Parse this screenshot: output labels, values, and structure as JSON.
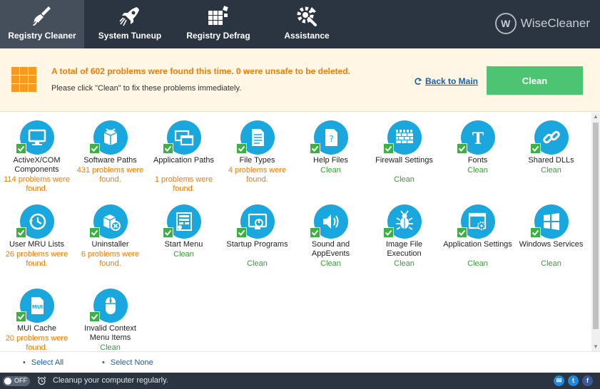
{
  "toolbar": {
    "tabs": [
      {
        "label": "Registry Cleaner",
        "icon": "broom-icon",
        "active": true
      },
      {
        "label": "System Tuneup",
        "icon": "rocket-icon",
        "active": false
      },
      {
        "label": "Registry Defrag",
        "icon": "defrag-icon",
        "active": false
      },
      {
        "label": "Assistance",
        "icon": "tools-icon",
        "active": false
      }
    ],
    "brand": "WiseCleaner",
    "brand_mark": "W"
  },
  "banner": {
    "title": "A total of 602 problems were found this time. 0 were unsafe to be deleted.",
    "subtitle": "Please click \"Clean\" to fix these problems immediately.",
    "back_label": "Back to Main",
    "clean_label": "Clean"
  },
  "items": [
    {
      "name": "ActiveX/COM Components",
      "status": "114 problems were found.",
      "kind": "warn",
      "icon": "monitor-icon",
      "checked": true
    },
    {
      "name": "Software Paths",
      "status": "431 problems were found.",
      "kind": "warn",
      "icon": "package-icon",
      "checked": true
    },
    {
      "name": "Application Paths",
      "status": "1 problems were found.",
      "kind": "warn",
      "icon": "windows-icon",
      "checked": true
    },
    {
      "name": "File Types",
      "status": "4 problems were found.",
      "kind": "warn",
      "icon": "file-icon",
      "checked": true
    },
    {
      "name": "Help Files",
      "status": "Clean",
      "kind": "ok",
      "icon": "help-file-icon",
      "checked": true
    },
    {
      "name": "Firewall Settings",
      "status": "Clean",
      "kind": "ok",
      "icon": "firewall-icon",
      "checked": true
    },
    {
      "name": "Fonts",
      "status": "Clean",
      "kind": "ok",
      "icon": "font-icon",
      "checked": true
    },
    {
      "name": "Shared DLLs",
      "status": "Clean",
      "kind": "ok",
      "icon": "link-icon",
      "checked": true
    },
    {
      "name": "User MRU Lists",
      "status": "26 problems were found.",
      "kind": "warn",
      "icon": "clock-icon",
      "checked": true
    },
    {
      "name": "Uninstaller",
      "status": "6 problems were found.",
      "kind": "warn",
      "icon": "uninstall-icon",
      "checked": true
    },
    {
      "name": "Start Menu",
      "status": "Clean",
      "kind": "ok",
      "icon": "start-menu-icon",
      "checked": true
    },
    {
      "name": "Startup Programs",
      "status": "Clean",
      "kind": "ok",
      "icon": "power-icon",
      "checked": true
    },
    {
      "name": "Sound and AppEvents",
      "status": "Clean",
      "kind": "ok",
      "icon": "speaker-icon",
      "checked": true
    },
    {
      "name": "Image File Execution",
      "status": "Clean",
      "kind": "ok",
      "icon": "bug-icon",
      "checked": true
    },
    {
      "name": "Application Settings",
      "status": "Clean",
      "kind": "ok",
      "icon": "app-settings-icon",
      "checked": true
    },
    {
      "name": "Windows Services",
      "status": "Clean",
      "kind": "ok",
      "icon": "windows-logo-icon",
      "checked": true
    },
    {
      "name": "MUI Cache",
      "status": "20 problems were found.",
      "kind": "warn",
      "icon": "mui-file-icon",
      "checked": true
    },
    {
      "name": "Invalid Context Menu Items",
      "status": "Clean",
      "kind": "ok",
      "icon": "mouse-icon",
      "checked": true
    }
  ],
  "select": {
    "all_label": "Select All",
    "none_label": "Select None"
  },
  "statusbar": {
    "toggle_label": "OFF",
    "message": "Cleanup your computer regularly.",
    "social": [
      {
        "icon": "email-icon",
        "glyph": "✉"
      },
      {
        "icon": "twitter-icon",
        "glyph": "t"
      },
      {
        "icon": "facebook-icon",
        "glyph": "f"
      }
    ]
  },
  "colors": {
    "accent": "#1aa7de",
    "warning": "#ef7d00",
    "clean": "#3a9a3a",
    "button": "#4cc472",
    "toolbar": "#2b3541"
  }
}
